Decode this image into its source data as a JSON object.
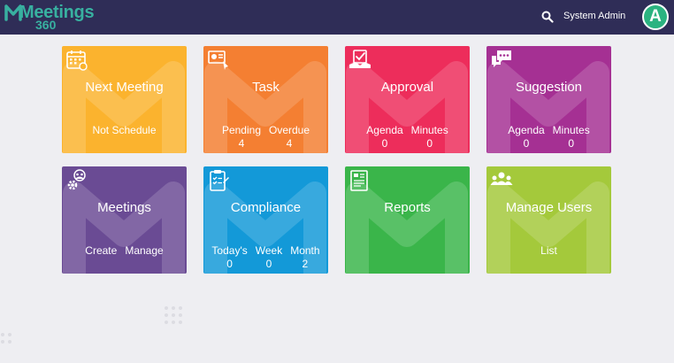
{
  "header": {
    "logo_word": "Meetings",
    "logo_num": "360",
    "user_name": "System Admin",
    "avatar_letter": "A"
  },
  "tiles": {
    "next_meeting": {
      "title": "Next Meeting",
      "status": "Not Schedule",
      "color": "#fbb32e"
    },
    "task": {
      "title": "Task",
      "pending_label": "Pending",
      "pending_value": "4",
      "overdue_label": "Overdue",
      "overdue_value": "4",
      "color": "#f47f32"
    },
    "approval": {
      "title": "Approval",
      "agenda_label": "Agenda",
      "agenda_value": "0",
      "minutes_label": "Minutes",
      "minutes_value": "0",
      "color": "#ed2d5b"
    },
    "suggestion": {
      "title": "Suggestion",
      "agenda_label": "Agenda",
      "agenda_value": "0",
      "minutes_label": "Minutes",
      "minutes_value": "0",
      "color": "#a53093"
    },
    "meetings": {
      "title": "Meetings",
      "create_label": "Create",
      "manage_label": "Manage",
      "color": "#6a4b94"
    },
    "compliance": {
      "title": "Compliance",
      "today_label": "Today's",
      "today_value": "0",
      "week_label": "Week",
      "week_value": "0",
      "month_label": "Month",
      "month_value": "2",
      "color": "#1399d8"
    },
    "reports": {
      "title": "Reports",
      "color": "#3ab54a"
    },
    "manage_users": {
      "title": "Manage Users",
      "list_label": "List",
      "color": "#a4c93b"
    }
  }
}
